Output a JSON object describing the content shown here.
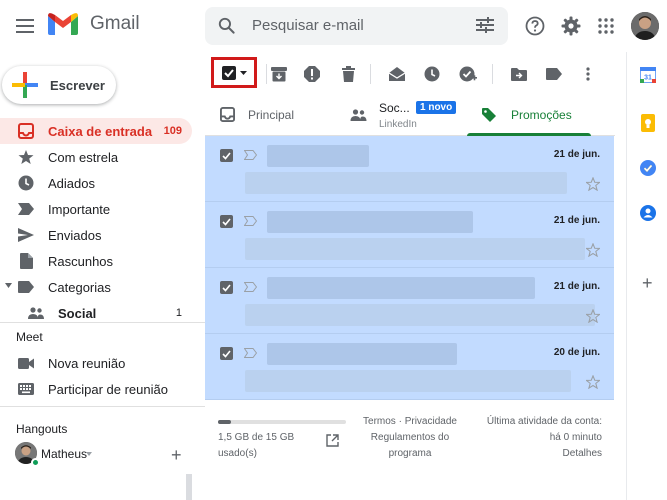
{
  "header": {
    "app_name": "Gmail",
    "search_placeholder": "Pesquisar e-mail"
  },
  "sidebar": {
    "compose_label": "Escrever",
    "items": [
      {
        "label": "Caixa de entrada",
        "count": "109",
        "icon": "inbox-icon",
        "active": true
      },
      {
        "label": "Com estrela",
        "icon": "star-icon"
      },
      {
        "label": "Adiados",
        "icon": "clock-icon"
      },
      {
        "label": "Importante",
        "icon": "important-icon"
      },
      {
        "label": "Enviados",
        "icon": "send-icon"
      },
      {
        "label": "Rascunhos",
        "icon": "draft-icon"
      },
      {
        "label": "Categorias",
        "icon": "label-icon"
      },
      {
        "label": "Social",
        "count": "1",
        "icon": "people-icon"
      }
    ],
    "meet": {
      "title": "Meet",
      "items": [
        {
          "label": "Nova reunião",
          "icon": "video-icon"
        },
        {
          "label": "Participar de reunião",
          "icon": "keyboard-icon"
        }
      ]
    },
    "hangouts": {
      "title": "Hangouts",
      "user": "Matheus"
    }
  },
  "tabs": [
    {
      "label": "Principal",
      "icon": "inbox-icon"
    },
    {
      "label": "Soc...",
      "sub": "LinkedIn",
      "badge": "1 novo",
      "icon": "people-icon"
    },
    {
      "label": "Promoções",
      "icon": "tag-icon",
      "active": true
    }
  ],
  "emails": [
    {
      "date": "21 de jun.",
      "selected": true
    },
    {
      "date": "21 de jun.",
      "selected": true
    },
    {
      "date": "21 de jun.",
      "selected": true
    },
    {
      "date": "20 de jun.",
      "selected": true
    }
  ],
  "footer": {
    "storage_text": "1,5 GB de 15 GB usado(s)",
    "storage_fraction": 0.1,
    "terms": "Termos",
    "privacy": "Privacidade",
    "program_policies": "Regulamentos do programa",
    "last_activity": "Última atividade da conta: há 0 minuto",
    "details": "Detalhes"
  },
  "colors": {
    "accent_red": "#d93025",
    "selected_row": "#c2dbff",
    "promo_green": "#188038",
    "badge_blue": "#1a73e8",
    "highlight_box": "#d11a1a"
  }
}
